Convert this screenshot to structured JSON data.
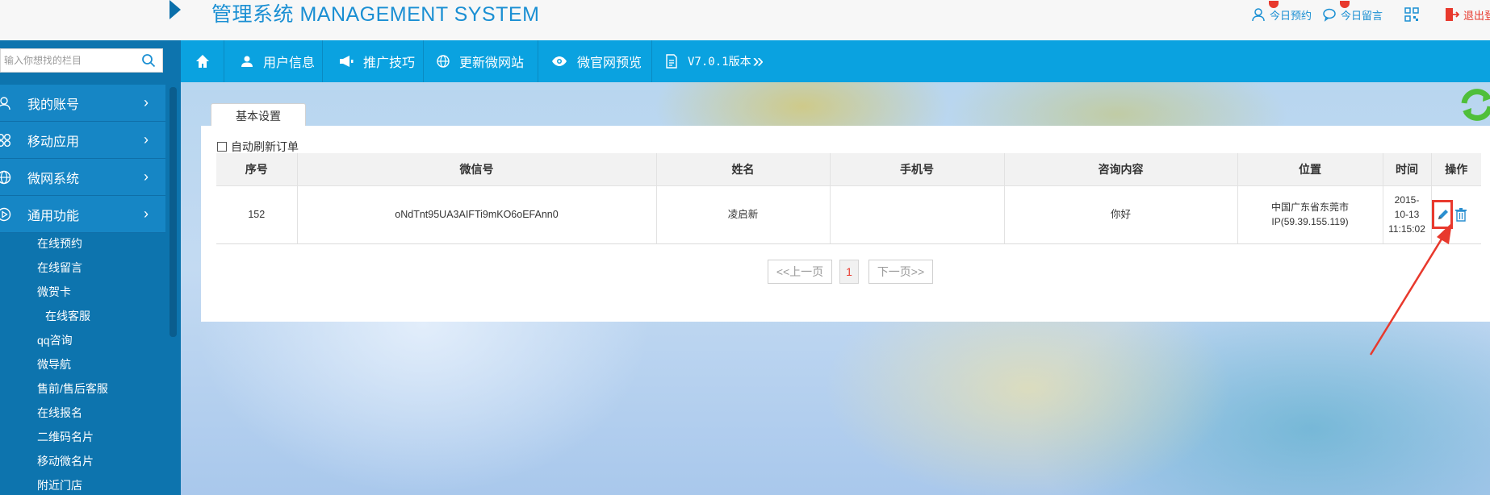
{
  "header": {
    "title": "管理系统 MANAGEMENT SYSTEM",
    "today_booking": "今日预约",
    "today_message": "今日留言",
    "logout": "退出登"
  },
  "sidebar": {
    "search_placeholder": "输入你想找的栏目",
    "menu": [
      {
        "label": "我的账号",
        "icon": "user-icon"
      },
      {
        "label": "移动应用",
        "icon": "apps-icon"
      },
      {
        "label": "微网系统",
        "icon": "globe-icon"
      },
      {
        "label": "通用功能",
        "icon": "play-icon"
      }
    ],
    "sub_items": [
      "在线预约",
      "在线留言",
      "微贺卡",
      "在线客服",
      "qq咨询",
      "微导航",
      "售前/售后客服",
      "在线报名",
      "二维码名片",
      "移动微名片",
      "附近门店"
    ],
    "arrow": "›"
  },
  "nav": {
    "items": [
      {
        "label": "用户信息",
        "icon": "user-icon"
      },
      {
        "label": "推广技巧",
        "icon": "megaphone-icon"
      },
      {
        "label": "更新微网站",
        "icon": "globe-icon"
      },
      {
        "label": "微官网预览",
        "icon": "eye-icon"
      },
      {
        "label": "V7.0.1版本",
        "icon": "document-icon"
      }
    ],
    "more": "»"
  },
  "main": {
    "tab_label": "基本设置",
    "auto_refresh_label": "自动刷新订单",
    "columns": [
      "序号",
      "微信号",
      "姓名",
      "手机号",
      "咨询内容",
      "位置",
      "时间",
      "操作"
    ],
    "rows": [
      {
        "id": "152",
        "wechat": "oNdTnt95UA3AIFTi9mKO6oEFAnn0",
        "name": "凌启新",
        "phone": "",
        "content": "你好",
        "location_line1": "中国广东省东莞市",
        "location_line2": "IP(59.39.155.119)",
        "time_line1": "2015-",
        "time_line2": "10-13",
        "time_line3": "11:15:02"
      }
    ],
    "pager": {
      "prev": "<<上一页",
      "current": "1",
      "next": "下一页>>"
    }
  },
  "colors": {
    "accent": "#0aa2e0",
    "sidebar_bg": "#0d74ae",
    "highlight": "#e8392d"
  }
}
